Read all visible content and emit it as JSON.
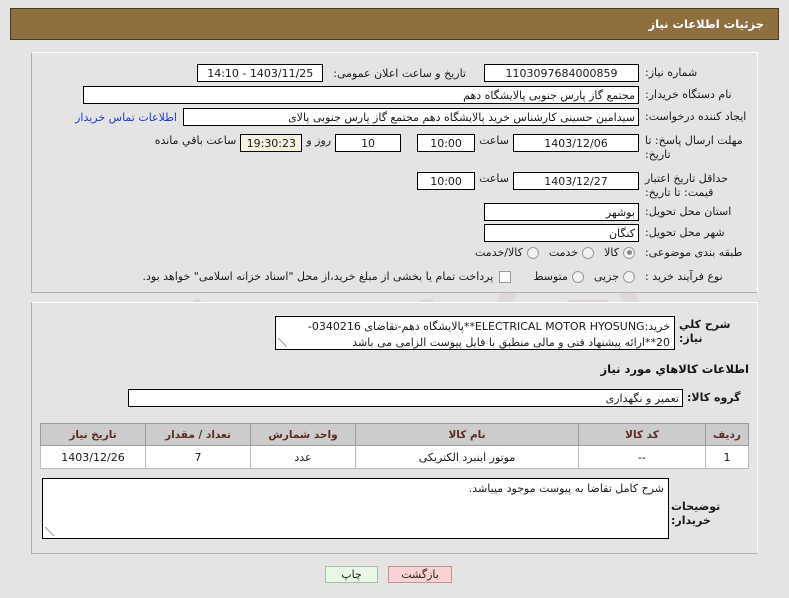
{
  "header": {
    "title": "جزئیات اطلاعات نیاز"
  },
  "form": {
    "need_number": {
      "label": "شماره نیاز:",
      "value": "1103097684000859"
    },
    "public_announce": {
      "label": "تاریخ و ساعت اعلان عمومی:",
      "value": "1403/11/25 - 14:10"
    },
    "buyer_org": {
      "label": "نام دستگاه خریدار:",
      "value": "مجتمع گاز پارس جنوبی  پالایشگاه دهم"
    },
    "requester": {
      "label": "ایجاد کننده درخواست:",
      "value": "سیدامین حسینی کارشناس خرید پالایشگاه دهم  مجتمع گاز پارس جنوبی  پالای",
      "link": "اطلاعات تماس خریدار"
    },
    "reply_deadline": {
      "label": "مهلت ارسال پاسخ: تا تاریخ:",
      "date": "1403/12/06",
      "time_label": "ساعت",
      "time": "10:00",
      "days": "10",
      "days_label": "روز و",
      "countdown": "19:30:23",
      "countdown_label": "ساعت باقي مانده"
    },
    "price_validity": {
      "label": "حداقل تاریخ اعتبار قیمت: تا تاریخ:",
      "date": "1403/12/27",
      "time_label": "ساعت",
      "time": "10:00"
    },
    "province": {
      "label": "استان محل تحویل:",
      "value": "بوشهر"
    },
    "city": {
      "label": "شهر محل تحویل:",
      "value": "کنگان"
    },
    "subject_class": {
      "label": "طبقه بندی موضوعی:",
      "options": [
        {
          "label": "کالا",
          "selected": true
        },
        {
          "label": "خدمت",
          "selected": false
        },
        {
          "label": "کالا/خدمت",
          "selected": false
        }
      ]
    },
    "process_type": {
      "label": "نوع فرآیند خرید :",
      "options": [
        {
          "label": "جزیی",
          "selected": false
        },
        {
          "label": "متوسط",
          "selected": false
        }
      ],
      "checkbox": {
        "label": "پرداخت تمام یا بخشی از مبلغ خرید،از محل \"اسناد خزانه اسلامی\" خواهد بود.",
        "checked": false
      }
    }
  },
  "description": {
    "label": "شرح كلي نياز:",
    "value": "خرید:ELECTRICAL MOTOR HYOSUNG**پالایشگاه دهم-تقاضای 0340216-20**ارائه پیشنهاد فنی و مالی منطبق با فایل پیوست الزامی می باشد"
  },
  "goods_section": {
    "heading": "اطلاعات كالاهاي مورد نياز",
    "group": {
      "label": "گروه کالا:",
      "value": "تعمیر و نگهداری"
    },
    "table": {
      "headers": [
        "ردیف",
        "کد کالا",
        "نام کالا",
        "واحد شمارش",
        "تعداد / مقدار",
        "تاریخ نیاز"
      ],
      "rows": [
        [
          "1",
          "--",
          "موتور اینبرد الکتریکی",
          "عدد",
          "7",
          "1403/12/26"
        ]
      ]
    }
  },
  "buyer_notes": {
    "label": "توضیحات خریدار:",
    "value": "شرح کامل تقاضا به پیوست موجود میباشد."
  },
  "buttons": {
    "back": "بازگشت",
    "print": "چاپ"
  },
  "watermark": {
    "text": "irantender.net"
  },
  "colors": {
    "header_bg": "#8e6f40",
    "page_bg": "#e4e4e4",
    "link": "#1642c8",
    "table_header_bg": "#cccccc",
    "table_header_text": "#5d2b22",
    "btn_back_bg": "#fbd2d2",
    "btn_print_bg": "#e9f7e6",
    "countdown_bg": "#f5f3df"
  }
}
